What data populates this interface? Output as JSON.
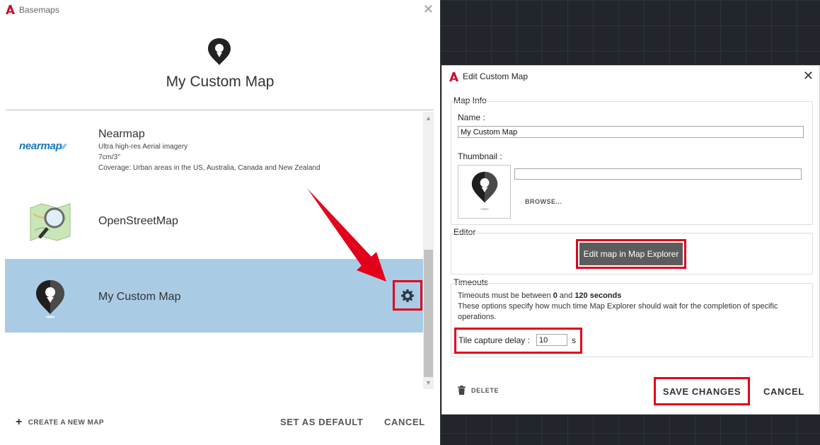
{
  "basemaps_window": {
    "title": "Basemaps",
    "close_glyph": "✕",
    "header_title": "My Custom Map",
    "maps": [
      {
        "name": "Nearmap",
        "logo_text": "nearmap",
        "desc_lines": [
          "Ultra high-res Aerial imagery",
          "7cm/3''",
          "Coverage: Urban areas in the US, Australia, Canada and New Zealand"
        ]
      },
      {
        "name": "OpenStreetMap"
      },
      {
        "name": "My Custom Map",
        "selected": true
      }
    ],
    "footer": {
      "create_label": "CREATE A NEW MAP",
      "set_default_label": "SET AS DEFAULT",
      "cancel_label": "CANCEL"
    }
  },
  "edit_dialog": {
    "title": "Edit Custom Map",
    "close_glyph": "✕",
    "map_info": {
      "group_label": "Map Info",
      "name_label": "Name :",
      "name_value": "My Custom Map",
      "thumbnail_label": "Thumbnail :",
      "thumbnail_path": "",
      "browse_label": "BROWSE..."
    },
    "editor": {
      "group_label": "Editor",
      "button_label": "Edit map in Map Explorer"
    },
    "timeouts": {
      "group_label": "Timeouts",
      "line1_prefix": "Timeouts must be between ",
      "min_value": "0",
      "line1_and": " and ",
      "max_value": "120 seconds",
      "line2": "These options specify how much time Map Explorer should wait for the completion of specific",
      "line3": "operations.",
      "tile_label": "Tile capture delay :",
      "tile_value": "10",
      "tile_unit": "s"
    },
    "footer": {
      "delete_label": "DELETE",
      "save_label": "SAVE CHANGES",
      "cancel_label": "CANCEL"
    }
  },
  "colors": {
    "highlight_red": "#e3001b",
    "selected_row": "#a9cce4",
    "autocad_red": "#c8102e"
  }
}
